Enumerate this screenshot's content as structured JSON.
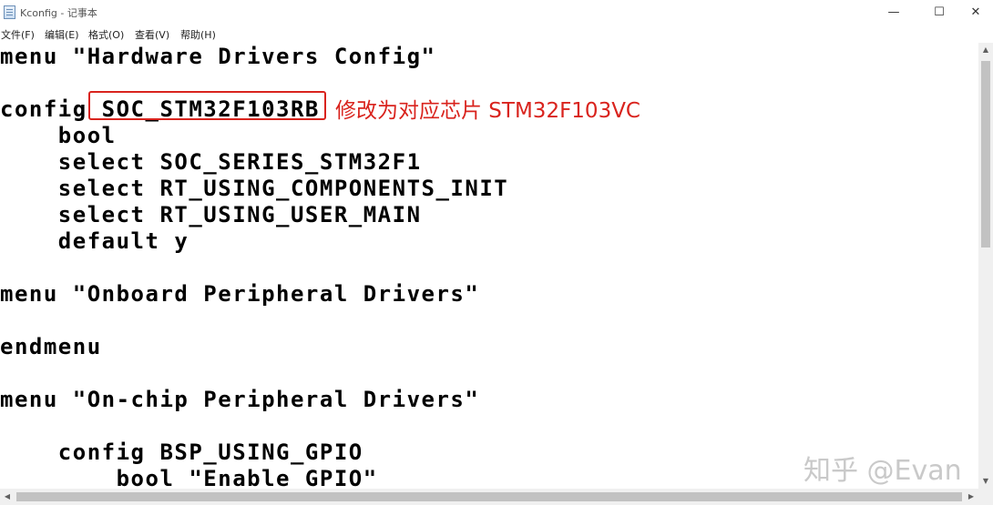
{
  "window": {
    "title": "Kconfig - 记事本",
    "controls": {
      "minimize": "—",
      "maximize": "☐",
      "close": "✕"
    }
  },
  "menubar": [
    {
      "label": "文件(F)"
    },
    {
      "label": "编辑(E)"
    },
    {
      "label": "格式(O)"
    },
    {
      "label": "查看(V)"
    },
    {
      "label": "帮助(H)"
    }
  ],
  "editor": {
    "lines": [
      "menu \"Hardware Drivers Config\"",
      "",
      "config SOC_STM32F103RB",
      "    bool",
      "    select SOC_SERIES_STM32F1",
      "    select RT_USING_COMPONENTS_INIT",
      "    select RT_USING_USER_MAIN",
      "    default y",
      "",
      "menu \"Onboard Peripheral Drivers\"",
      "",
      "endmenu",
      "",
      "menu \"On-chip Peripheral Drivers\"",
      "",
      "    config BSP_USING_GPIO",
      "        bool \"Enable GPIO\""
    ]
  },
  "annotation": {
    "text": "修改为对应芯片 STM32F103VC",
    "color": "#d9231d"
  },
  "watermark": "知乎 @Evan"
}
